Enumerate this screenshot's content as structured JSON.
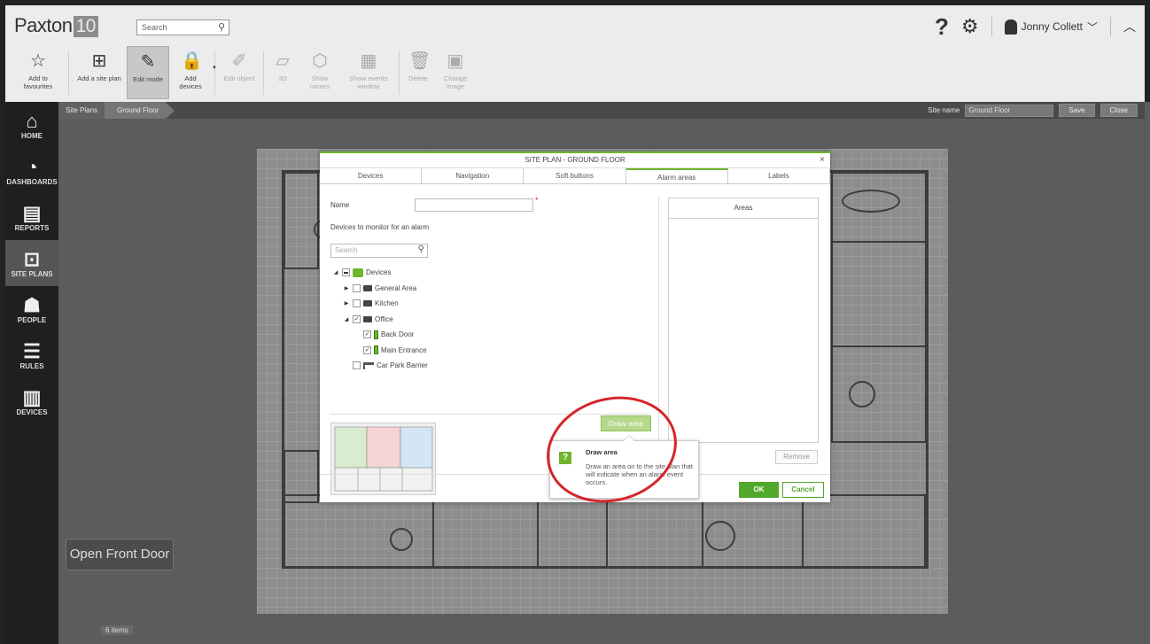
{
  "app": {
    "logo_text": "Paxton",
    "logo_num": "10",
    "search_placeholder": "Search",
    "user_name": "Jonny Collett"
  },
  "toolbar": [
    {
      "label": "Add to favourites",
      "icon": "star-icon",
      "state": "normal"
    },
    {
      "label": "Add a site plan",
      "icon": "site-plan-add-icon",
      "state": "normal",
      "dropdown": true
    },
    {
      "label": "Edit mode",
      "icon": "edit-mode-icon",
      "state": "active"
    },
    {
      "label": "Add devices",
      "icon": "lock-icon",
      "state": "normal",
      "dropdown": true
    },
    {
      "label": "Edit object",
      "icon": "edit-object-icon",
      "state": "disabled"
    },
    {
      "label": "3D",
      "icon": "3d-icon",
      "state": "disabled"
    },
    {
      "label": "Show names",
      "icon": "tag-icon",
      "state": "disabled"
    },
    {
      "label": "Show events window",
      "icon": "events-window-icon",
      "state": "disabled"
    },
    {
      "label": "Delete",
      "icon": "trash-icon",
      "state": "disabled"
    },
    {
      "label": "Change image",
      "icon": "image-icon",
      "state": "disabled"
    }
  ],
  "sidenav": [
    {
      "label": "HOME",
      "icon": "home-icon",
      "active": false
    },
    {
      "label": "DASHBOARDS",
      "icon": "dashboard-icon",
      "active": false
    },
    {
      "label": "REPORTS",
      "icon": "reports-icon",
      "active": false
    },
    {
      "label": "SITE PLANS",
      "icon": "site-plans-icon",
      "active": true
    },
    {
      "label": "PEOPLE",
      "icon": "people-icon",
      "active": false
    },
    {
      "label": "RULES",
      "icon": "rules-icon",
      "active": false
    },
    {
      "label": "DEVICES",
      "icon": "devices-icon",
      "active": false
    }
  ],
  "breadcrumb": {
    "root": "Site Plans",
    "current": "Ground Floor"
  },
  "site": {
    "name_label": "Site name",
    "name_value": "Ground Floor",
    "save": "Save",
    "close": "Close"
  },
  "canvas": {
    "open_front_door": "Open Front Door",
    "item_count": "6 items"
  },
  "modal": {
    "title": "SITE PLAN - GROUND FLOOR",
    "close": "×",
    "tabs": [
      "Devices",
      "Navigation",
      "Soft buttons",
      "Alarm areas",
      "Labels"
    ],
    "active_tab": "Alarm areas",
    "name_label": "Name",
    "name_value": "",
    "required_mark": "*",
    "monitor_label": "Devices to monitor for an alarm",
    "search_placeholder": "Search",
    "tree": [
      {
        "label": "Devices",
        "level": 0,
        "expand": "open",
        "check": "partial",
        "icon": "devices-group"
      },
      {
        "label": "General Area",
        "level": 1,
        "expand": "closed",
        "check": "none",
        "icon": "folder"
      },
      {
        "label": "Kitchen",
        "level": 1,
        "expand": "closed",
        "check": "none",
        "icon": "folder"
      },
      {
        "label": "Office",
        "level": 1,
        "expand": "open",
        "check": "checked",
        "icon": "folder"
      },
      {
        "label": "Back Door",
        "level": 2,
        "expand": "",
        "check": "checked",
        "icon": "door"
      },
      {
        "label": "Main Entrance",
        "level": 2,
        "expand": "",
        "check": "checked",
        "icon": "door"
      },
      {
        "label": "Car Park Barrier",
        "level": 1,
        "expand": "",
        "check": "none",
        "icon": "barrier"
      }
    ],
    "draw_area": "Draw area",
    "areas_header": "Areas",
    "remove": "Remove",
    "ok": "OK",
    "cancel": "Cancel"
  },
  "tooltip": {
    "title": "Draw area",
    "text": "Draw an area on to the site plan that will indicate when an alarm event occurs."
  },
  "colors": {
    "accent": "#6fb52c",
    "highlight": "#d6252a"
  }
}
